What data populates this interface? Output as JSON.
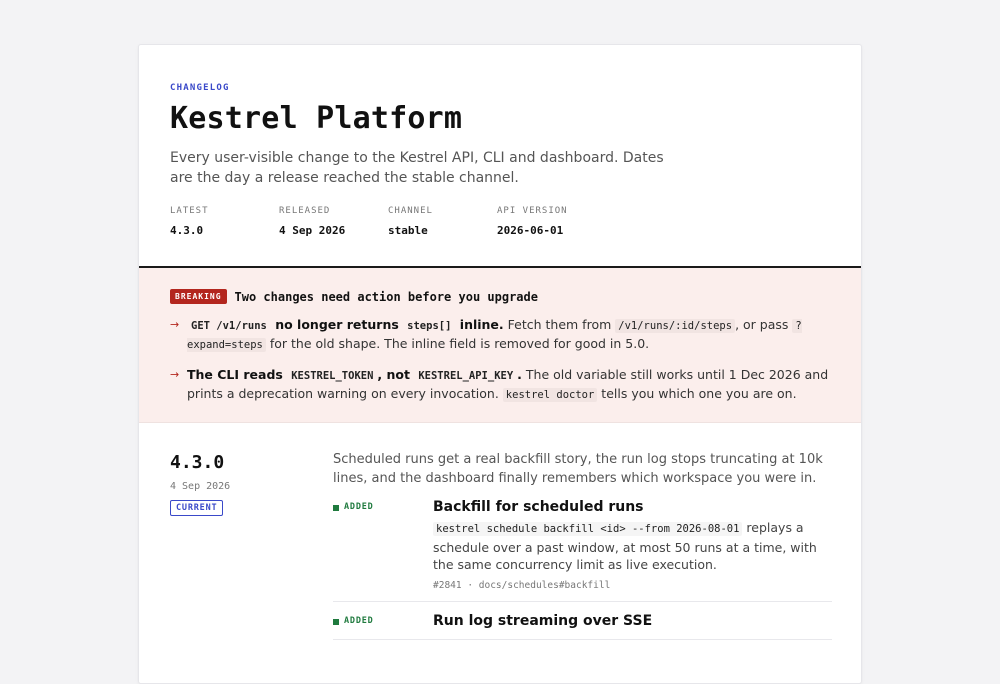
{
  "header": {
    "eyebrow": "CHANGELOG",
    "title": "Kestrel Platform",
    "subtitle": "Every user-visible change to the Kestrel API, CLI and dashboard. Dates are the day a release reached the stable channel.",
    "meta": [
      {
        "label": "LATEST",
        "value": "4.3.0"
      },
      {
        "label": "RELEASED",
        "value": "4 Sep 2026"
      },
      {
        "label": "CHANNEL",
        "value": "stable"
      },
      {
        "label": "API VERSION",
        "value": "2026-06-01"
      }
    ]
  },
  "breaking": {
    "badge": "BREAKING",
    "title": "Two changes need action before you upgrade",
    "arrow": "→",
    "item1": {
      "code1": "GET /v1/runs",
      "bold1": "no longer returns",
      "code2": "steps[]",
      "bold2": "inline.",
      "text1": "Fetch them from",
      "code3": "/v1/runs/:id/steps",
      "text2": ", or pass",
      "code4": "?expand=steps",
      "text3": "for the old shape. The inline field is removed for good in 5.0."
    },
    "item2": {
      "bold1": "The CLI reads",
      "code1": "KESTREL_TOKEN",
      "bold2": ", not",
      "code2": "KESTREL_API_KEY",
      "bold3": ".",
      "text1": "The old variable still works until 1 Dec 2026 and prints a deprecation warning on every invocation.",
      "code3": "kestrel doctor",
      "text2": "tells you which one you are on."
    }
  },
  "release": {
    "version": "4.3.0",
    "date": "4 Sep 2026",
    "badge": "CURRENT",
    "summary": "Scheduled runs get a real backfill story, the run log stops truncating at 10k lines, and the dashboard finally remembers which workspace you were in.",
    "changes": [
      {
        "type": "ADDED",
        "title": "Backfill for scheduled runs",
        "code": "kestrel schedule backfill <id> --from 2026-08-01",
        "desc": "replays a schedule over a past window, at most 50 runs at a time, with the same concurrency limit as live execution.",
        "refs": "#2841 · docs/schedules#backfill"
      },
      {
        "type": "ADDED",
        "title": "Run log streaming over SSE",
        "code": "",
        "desc": "",
        "refs": ""
      }
    ]
  },
  "colors": {
    "accent": "#3a49c9",
    "breaking": "#b3261e",
    "added": "#1f7a3e"
  }
}
